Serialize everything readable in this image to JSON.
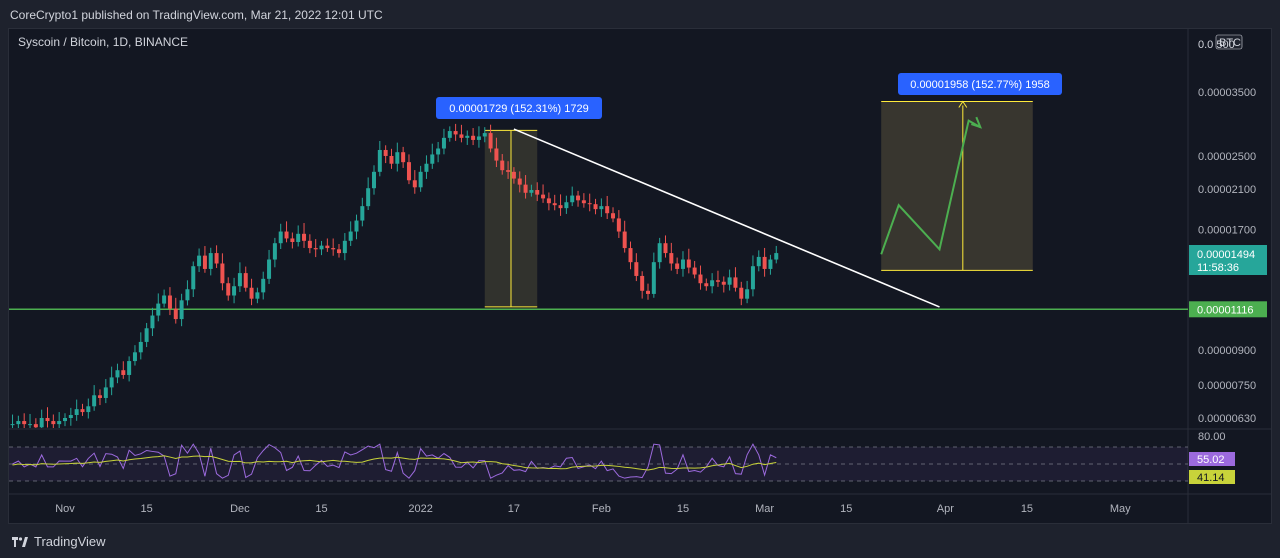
{
  "publisher_line": "CoreCrypto1 published on TradingView.com, Mar 21, 2022 12:01 UTC",
  "footer_brand": "TradingView",
  "icons": {
    "brand": "tradingview-logo-icon"
  },
  "colors": {
    "background": "#131722",
    "up": "#26a69a",
    "down": "#ef5350",
    "support_line": "#4caf50",
    "trendline": "#ffffff",
    "measure_label": "#2962ff",
    "projection": "#4caf50",
    "rsi": "#9c6ade",
    "rsi_ma": "#c8d33a"
  },
  "chart_data": {
    "type": "candlestick",
    "title": "Syscoin / Bitcoin, 1D, BINANCE",
    "currency_label": "BTC",
    "y_scale": "log",
    "y_ticks": [
      "0.00000630",
      "0.00000750",
      "0.00000900",
      "0.00001116",
      "0.00001700",
      "0.00002100",
      "0.00002500",
      "0.00003500"
    ],
    "top_tick_partial": "0.0 500",
    "x_ticks": [
      "Nov",
      "15",
      "Dec",
      "15",
      "2022",
      "17",
      "Feb",
      "15",
      "Mar",
      "15",
      "Apr",
      "15",
      "May"
    ],
    "current_price": {
      "value": "0.00001494",
      "countdown": "11:58:36"
    },
    "support_level": {
      "value": "0.00001116"
    },
    "measure_left": {
      "label": "0.00001729 (152.31%) 1729",
      "from": 1.13e-05,
      "to": 2.86e-05
    },
    "measure_right": {
      "label": "0.00001958 (152.77%) 1958",
      "from": 1.37e-05,
      "to": 3.33e-05
    },
    "trendline": {
      "from": {
        "date": "2022-01-17",
        "value": 2.88e-05
      },
      "to": {
        "date": "2022-03-31",
        "value": 1.13e-05
      }
    },
    "projection_path": [
      {
        "date": "2022-03-21",
        "value": 1.49e-05
      },
      {
        "date": "2022-03-24",
        "value": 1.93e-05
      },
      {
        "date": "2022-03-31",
        "value": 1.53e-05
      },
      {
        "date": "2022-04-05",
        "value": 3.01e-05
      },
      {
        "date": "2022-04-07",
        "value": 2.91e-05
      }
    ],
    "rsi": {
      "upper": "80.00",
      "value": "55.02",
      "ma_value": "41.14"
    },
    "series": [
      {
        "close": [
          6.2e-06,
          6.1e-06,
          6.1e-06,
          6.2e-06,
          6.1e-06,
          6.1e-06,
          6e-06,
          6.3e-06,
          6.2e-06,
          6.1e-06,
          6.2e-06,
          6.3e-06,
          6.4e-06,
          6.6e-06,
          6.5e-06,
          6.7e-06,
          7.1e-06,
          7e-06,
          7.4e-06,
          7.8e-06,
          8.1e-06,
          7.9e-06,
          8.5e-06,
          8.9e-06,
          9.4e-06,
          1.01e-05,
          1.08e-05,
          1.15e-05,
          1.2e-05,
          1.12e-05,
          1.06e-05,
          1.17e-05,
          1.24e-05,
          1.4e-05,
          1.48e-05,
          1.38e-05,
          1.5e-05,
          1.42e-05,
          1.28e-05,
          1.2e-05,
          1.26e-05,
          1.35e-05,
          1.25e-05,
          1.18e-05,
          1.22e-05,
          1.31e-05,
          1.45e-05,
          1.58e-05,
          1.68e-05,
          1.62e-05,
          1.59e-05,
          1.66e-05,
          1.6e-05,
          1.54e-05,
          1.53e-05,
          1.56e-05,
          1.54e-05,
          1.53e-05,
          1.5e-05,
          1.6e-05,
          1.68e-05,
          1.78e-05,
          1.92e-05,
          2.11e-05,
          2.3e-05,
          2.58e-05,
          2.5e-05,
          2.4e-05,
          2.55e-05,
          2.42e-05,
          2.2e-05,
          2.12e-05,
          2.3e-05,
          2.4e-05,
          2.52e-05,
          2.6e-05,
          2.75e-05,
          2.85e-05,
          2.8e-05,
          2.75e-05,
          2.78e-05,
          2.72e-05,
          2.77e-05,
          2.82e-05,
          2.6e-05,
          2.44e-05,
          2.32e-05,
          2.3e-05,
          2.22e-05,
          2.15e-05,
          2.06e-05,
          2.09e-05,
          2.04e-05,
          2e-05,
          1.95e-05,
          1.93e-05,
          1.9e-05,
          1.96e-05,
          2.03e-05,
          1.98e-05,
          1.95e-05,
          1.94e-05,
          1.89e-05,
          1.92e-05,
          1.85e-05,
          1.8e-05,
          1.68e-05,
          1.54e-05,
          1.43e-05,
          1.33e-05,
          1.23e-05,
          1.21e-05,
          1.43e-05,
          1.58e-05,
          1.5e-05,
          1.42e-05,
          1.38e-05,
          1.45e-05,
          1.39e-05,
          1.34e-05,
          1.28e-05,
          1.26e-05,
          1.3e-05,
          1.29e-05,
          1.27e-05,
          1.32e-05,
          1.25e-05,
          1.18e-05,
          1.24e-05,
          1.4e-05,
          1.47e-05,
          1.38e-05,
          1.45e-05,
          1.5e-05
        ]
      }
    ]
  }
}
